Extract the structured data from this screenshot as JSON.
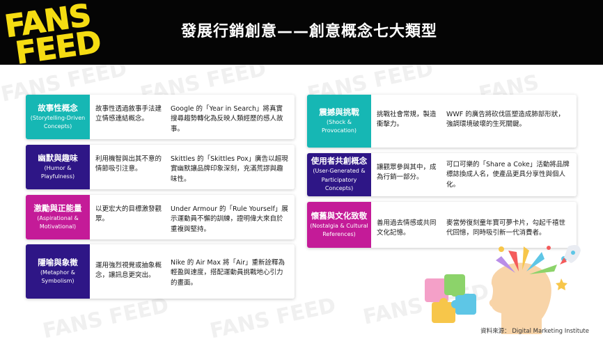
{
  "logo": {
    "line1": "FANS",
    "line2": "FEED"
  },
  "title": "發展行銷創意——創意概念七大類型",
  "watermark": "FANS FEED",
  "colors": {
    "teal": "#16b7b4",
    "indigo": "#2e1686",
    "magenta": "#c41b98",
    "header": "#050505",
    "logo": "#f5dc12"
  },
  "cards": [
    {
      "title": "故事性概念",
      "subtitle": "(Storytelling-Driven Concepts)",
      "description": "故事性透過敘事手法建立情感連結概念。",
      "example": "Google 的「Year in Search」將真實搜尋趨勢轉化為反映人類經歷的感人故事。"
    },
    {
      "title": "幽默與趣味",
      "subtitle": "(Humor & Playfulness)",
      "description": "利用機智與出其不意的情節吸引注意。",
      "example": "Skittles 的「Skittles Pox」廣告以超現實幽默讓品牌印象深刻，充滿荒謬與趣味性。"
    },
    {
      "title": "激勵與正能量",
      "subtitle": "(Aspirational & Motivational)",
      "description": "以更宏大的目標激發觀眾。",
      "example": "Under Armour 的「Rule Yourself」展示運動員不懈的訓練，證明偉大來自於重複與堅持。"
    },
    {
      "title": "隱喻與象徵",
      "subtitle": "(Metaphor & Symbolism)",
      "description": "運用強烈視覺或抽象概念，讓訊息更突出。",
      "example": "Nike 的 Air Max 將「Air」重新詮釋為輕盈與速度，搭配運動員挑戰地心引力的畫面。"
    },
    {
      "title": "震撼與挑戰",
      "subtitle": "(Shock & Provocation)",
      "description": "挑戰社會常規，製造衝擊力。",
      "example": "WWF 的廣告將砍伐區塑造成肺部形狀，強調環境破壞的生死關鍵。"
    },
    {
      "title": "使用者共創概念",
      "subtitle": "(User-Generated & Participatory Concepts)",
      "description": "讓觀眾參與其中，成為行銷一部分。",
      "example": "可口可樂的「Share a Coke」活動將品牌標誌換成人名，使產品更具分享性與個人化。"
    },
    {
      "title": "懷舊與文化致敬",
      "subtitle": "(Nostalgia & Cultural References)",
      "description": "善用過去情感或共同文化記憶。",
      "example": "麥當勞復刻童年寶可夢卡片，勾起千禧世代回憶，同時吸引新一代消費者。"
    }
  ],
  "source": "資料來源： Digital Marketing Institute",
  "illustration": "creative-head-illustration"
}
